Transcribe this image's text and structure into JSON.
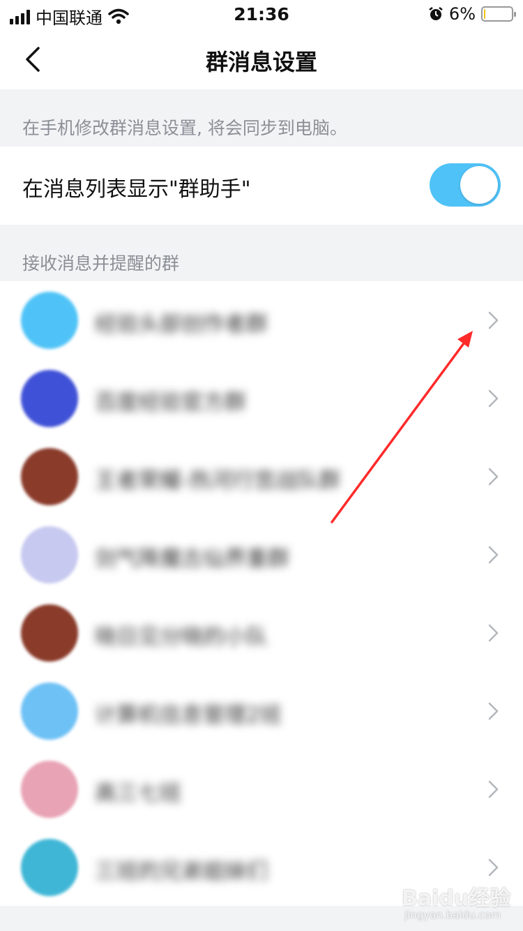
{
  "status_bar": {
    "carrier": "中国联通",
    "time": "21:36",
    "battery": "6%",
    "battery_level": 0.06,
    "icons": [
      "signal-icon",
      "wifi-icon",
      "alarm-icon",
      "battery-icon"
    ]
  },
  "nav": {
    "title": "群消息设置",
    "back_icon": "chevron-left-icon"
  },
  "hint": "在手机修改群消息设置, 将会同步到电脑。",
  "toggle": {
    "label": "在消息列表显示\"群助手\"",
    "on": true,
    "color": "#4fc2f7"
  },
  "section_title": "接收消息并提醒的群",
  "groups": [
    {
      "name": "经验头部创作者群",
      "avatar_color": "#4fc3f7"
    },
    {
      "name": "百度经验官方群",
      "avatar_color": "#3f51d6"
    },
    {
      "name": "王者荣耀-热河行宫战队群",
      "avatar_color": "#8a3b2a"
    },
    {
      "name": "剑气降魔古仙界重群",
      "avatar_color": "#c7c9f0"
    },
    {
      "name": "晓日见分晓的小队",
      "avatar_color": "#8a3b2a"
    },
    {
      "name": "计算机信息管理2班",
      "avatar_color": "#6ec1f5"
    },
    {
      "name": "高三七班",
      "avatar_color": "#e8a3b5"
    },
    {
      "name": "三班的兄弟姐妹们",
      "avatar_color": "#3fb6d6"
    }
  ],
  "annotation_arrow_color": "#ff2a2a",
  "watermark": {
    "main": "Baidu经验",
    "sub": "jingyan.baidu.com"
  }
}
